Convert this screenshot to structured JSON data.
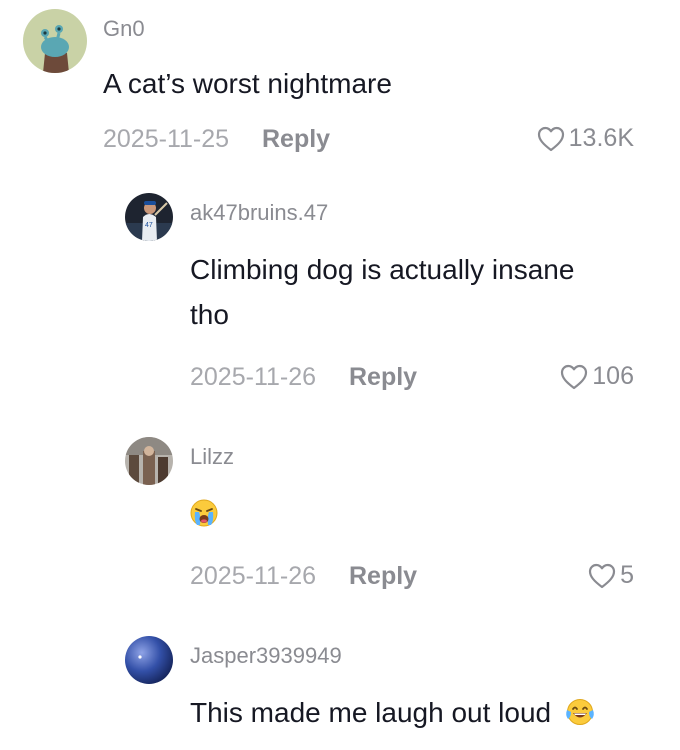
{
  "comments": [
    {
      "username": "Gn0",
      "text": "A cat’s worst nightmare",
      "date": "2025-11-25",
      "reply_label": "Reply",
      "likes": "13.6K",
      "avatar_icon": "snail-avatar-icon"
    },
    {
      "username": "ak47bruins.47",
      "text_line1": "Climbing dog is actually insane",
      "text_line2": "tho",
      "date": "2025-11-26",
      "reply_label": "Reply",
      "likes": "106",
      "avatar_icon": "baseball-player-avatar-icon"
    },
    {
      "username": "Lilzz",
      "emoji": "crying-face-icon",
      "date": "2025-11-26",
      "reply_label": "Reply",
      "likes": "5",
      "avatar_icon": "photo-avatar-icon"
    },
    {
      "username": "Jasper3939949",
      "text": "This made me laugh out loud",
      "emoji": "tears-of-joy-icon",
      "avatar_icon": "blue-sphere-avatar-icon"
    }
  ],
  "colors": {
    "username": "#8a8b91",
    "date": "#a7a8ad",
    "text": "#161823"
  }
}
